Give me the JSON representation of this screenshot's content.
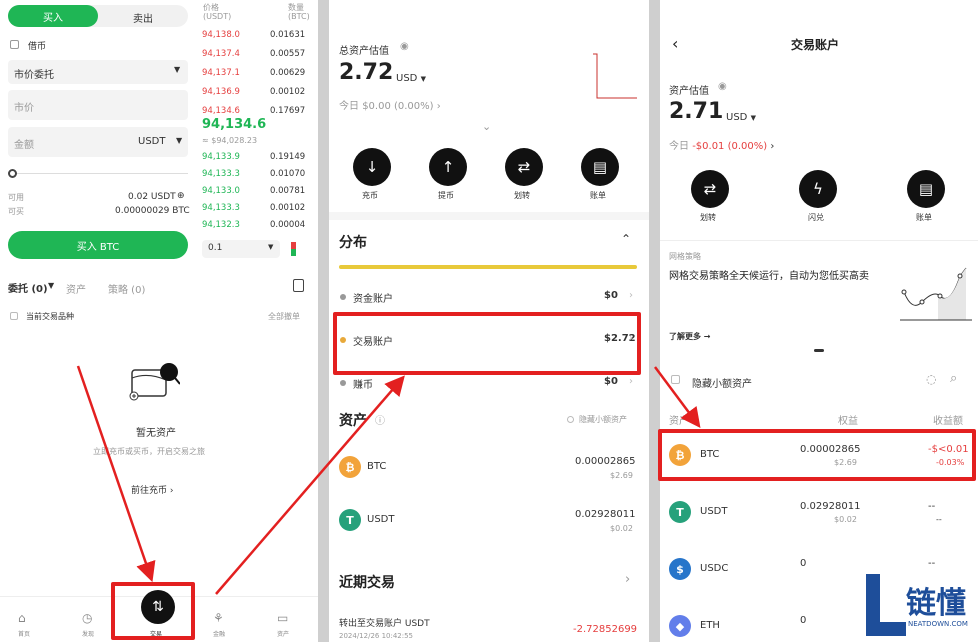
{
  "p1": {
    "tab_buy": "买入",
    "tab_sell": "卖出",
    "col_price": "价格",
    "col_price_unit": "(USDT)",
    "col_qty": "数量",
    "col_qty_unit": "(BTC)",
    "coin_check": "借币",
    "order_type": "市价委托",
    "price_placeholder": "市价",
    "qty_placeholder": "金额",
    "qty_unit": "USDT",
    "avail_label": "可用",
    "avail_value": "0.02 USDT",
    "canbuy_label": "可买",
    "canbuy_value": "0.00000029 BTC",
    "buy_button": "买入 BTC",
    "asks": [
      [
        "94,138.0",
        "0.01631"
      ],
      [
        "94,137.4",
        "0.00557"
      ],
      [
        "94,137.1",
        "0.00629"
      ],
      [
        "94,136.9",
        "0.00102"
      ],
      [
        "94,134.6",
        "0.17697"
      ]
    ],
    "last_price": "94,134.6",
    "last_usd": "≈ $94,028.23",
    "bids": [
      [
        "94,133.9",
        "0.19149"
      ],
      [
        "94,133.3",
        "0.01070"
      ],
      [
        "94,133.0",
        "0.00781"
      ],
      [
        "94,133.3",
        "0.00102"
      ],
      [
        "94,132.3",
        "0.00004"
      ]
    ],
    "depth": "0.1",
    "tab_orders": "委托 (0)",
    "tab_assets": "资产",
    "tab_strategy": "策略 (0)",
    "current_pair": "当前交易品种",
    "revoke_all": "全部撤单",
    "empty_title": "暂无资产",
    "empty_desc": "立即充币或买币，开启交易之旅",
    "deposit_link": "前往充币",
    "nav": [
      "首页",
      "发现",
      "交易",
      "金融",
      "资产"
    ]
  },
  "p2": {
    "total_label": "总资产估值",
    "total_value": "2.72",
    "total_unit": "USD",
    "today_label": "今日",
    "today_value": "$0.00 (0.00%)",
    "actions": [
      "充币",
      "提币",
      "划转",
      "账单"
    ],
    "dist_title": "分布",
    "dist_rows": [
      [
        "资金账户",
        "$0"
      ],
      [
        "交易账户",
        "$2.72"
      ],
      [
        "赚币",
        "$0"
      ]
    ],
    "assets_title": "资产",
    "hide_small": "隐藏小额资产",
    "assets": [
      {
        "sym": "BTC",
        "amount": "0.00002865",
        "usd": "$2.69",
        "color": "#f2a33a",
        "glyph": "₿"
      },
      {
        "sym": "USDT",
        "amount": "0.02928011",
        "usd": "$0.02",
        "color": "#26a17b",
        "glyph": "T"
      }
    ],
    "recent_title": "近期交易",
    "recent_desc": "转出至交易账户 USDT",
    "recent_time": "2024/12/26 10:42:55",
    "recent_amount": "-2.72852699"
  },
  "p3": {
    "title": "交易账户",
    "asset_label": "资产估值",
    "asset_value": "2.71",
    "asset_unit": "USD",
    "today_label": "今日",
    "today_value": "-$0.01 (0.00%)",
    "actions": [
      "划转",
      "闪兑",
      "账单"
    ],
    "banner_tag": "网格策略",
    "banner_text": "网格交易策略全天候运行，自动为您低买高卖",
    "banner_link": "了解更多",
    "hide_small": "隐藏小额资产",
    "col_asset": "资产",
    "col_equity": "权益",
    "col_pnl": "收益额",
    "assets": [
      {
        "sym": "BTC",
        "amount": "0.00002865",
        "usd": "$2.69",
        "pnl": "-$<0.01",
        "pct": "-0.03%",
        "color": "#f2a33a",
        "glyph": "₿"
      },
      {
        "sym": "USDT",
        "amount": "0.02928011",
        "usd": "$0.02",
        "pnl": "--",
        "pct": "--",
        "color": "#26a17b",
        "glyph": "T"
      },
      {
        "sym": "USDC",
        "amount": "0",
        "usd": "",
        "pnl": "--",
        "pct": "",
        "color": "#2775ca",
        "glyph": "$"
      },
      {
        "sym": "ETH",
        "amount": "0",
        "usd": "",
        "pnl": "",
        "pct": "",
        "color": "#627eea",
        "glyph": "◆"
      }
    ]
  },
  "watermark": {
    "brand": "链懂",
    "site": "NEATDOWN.COM"
  }
}
